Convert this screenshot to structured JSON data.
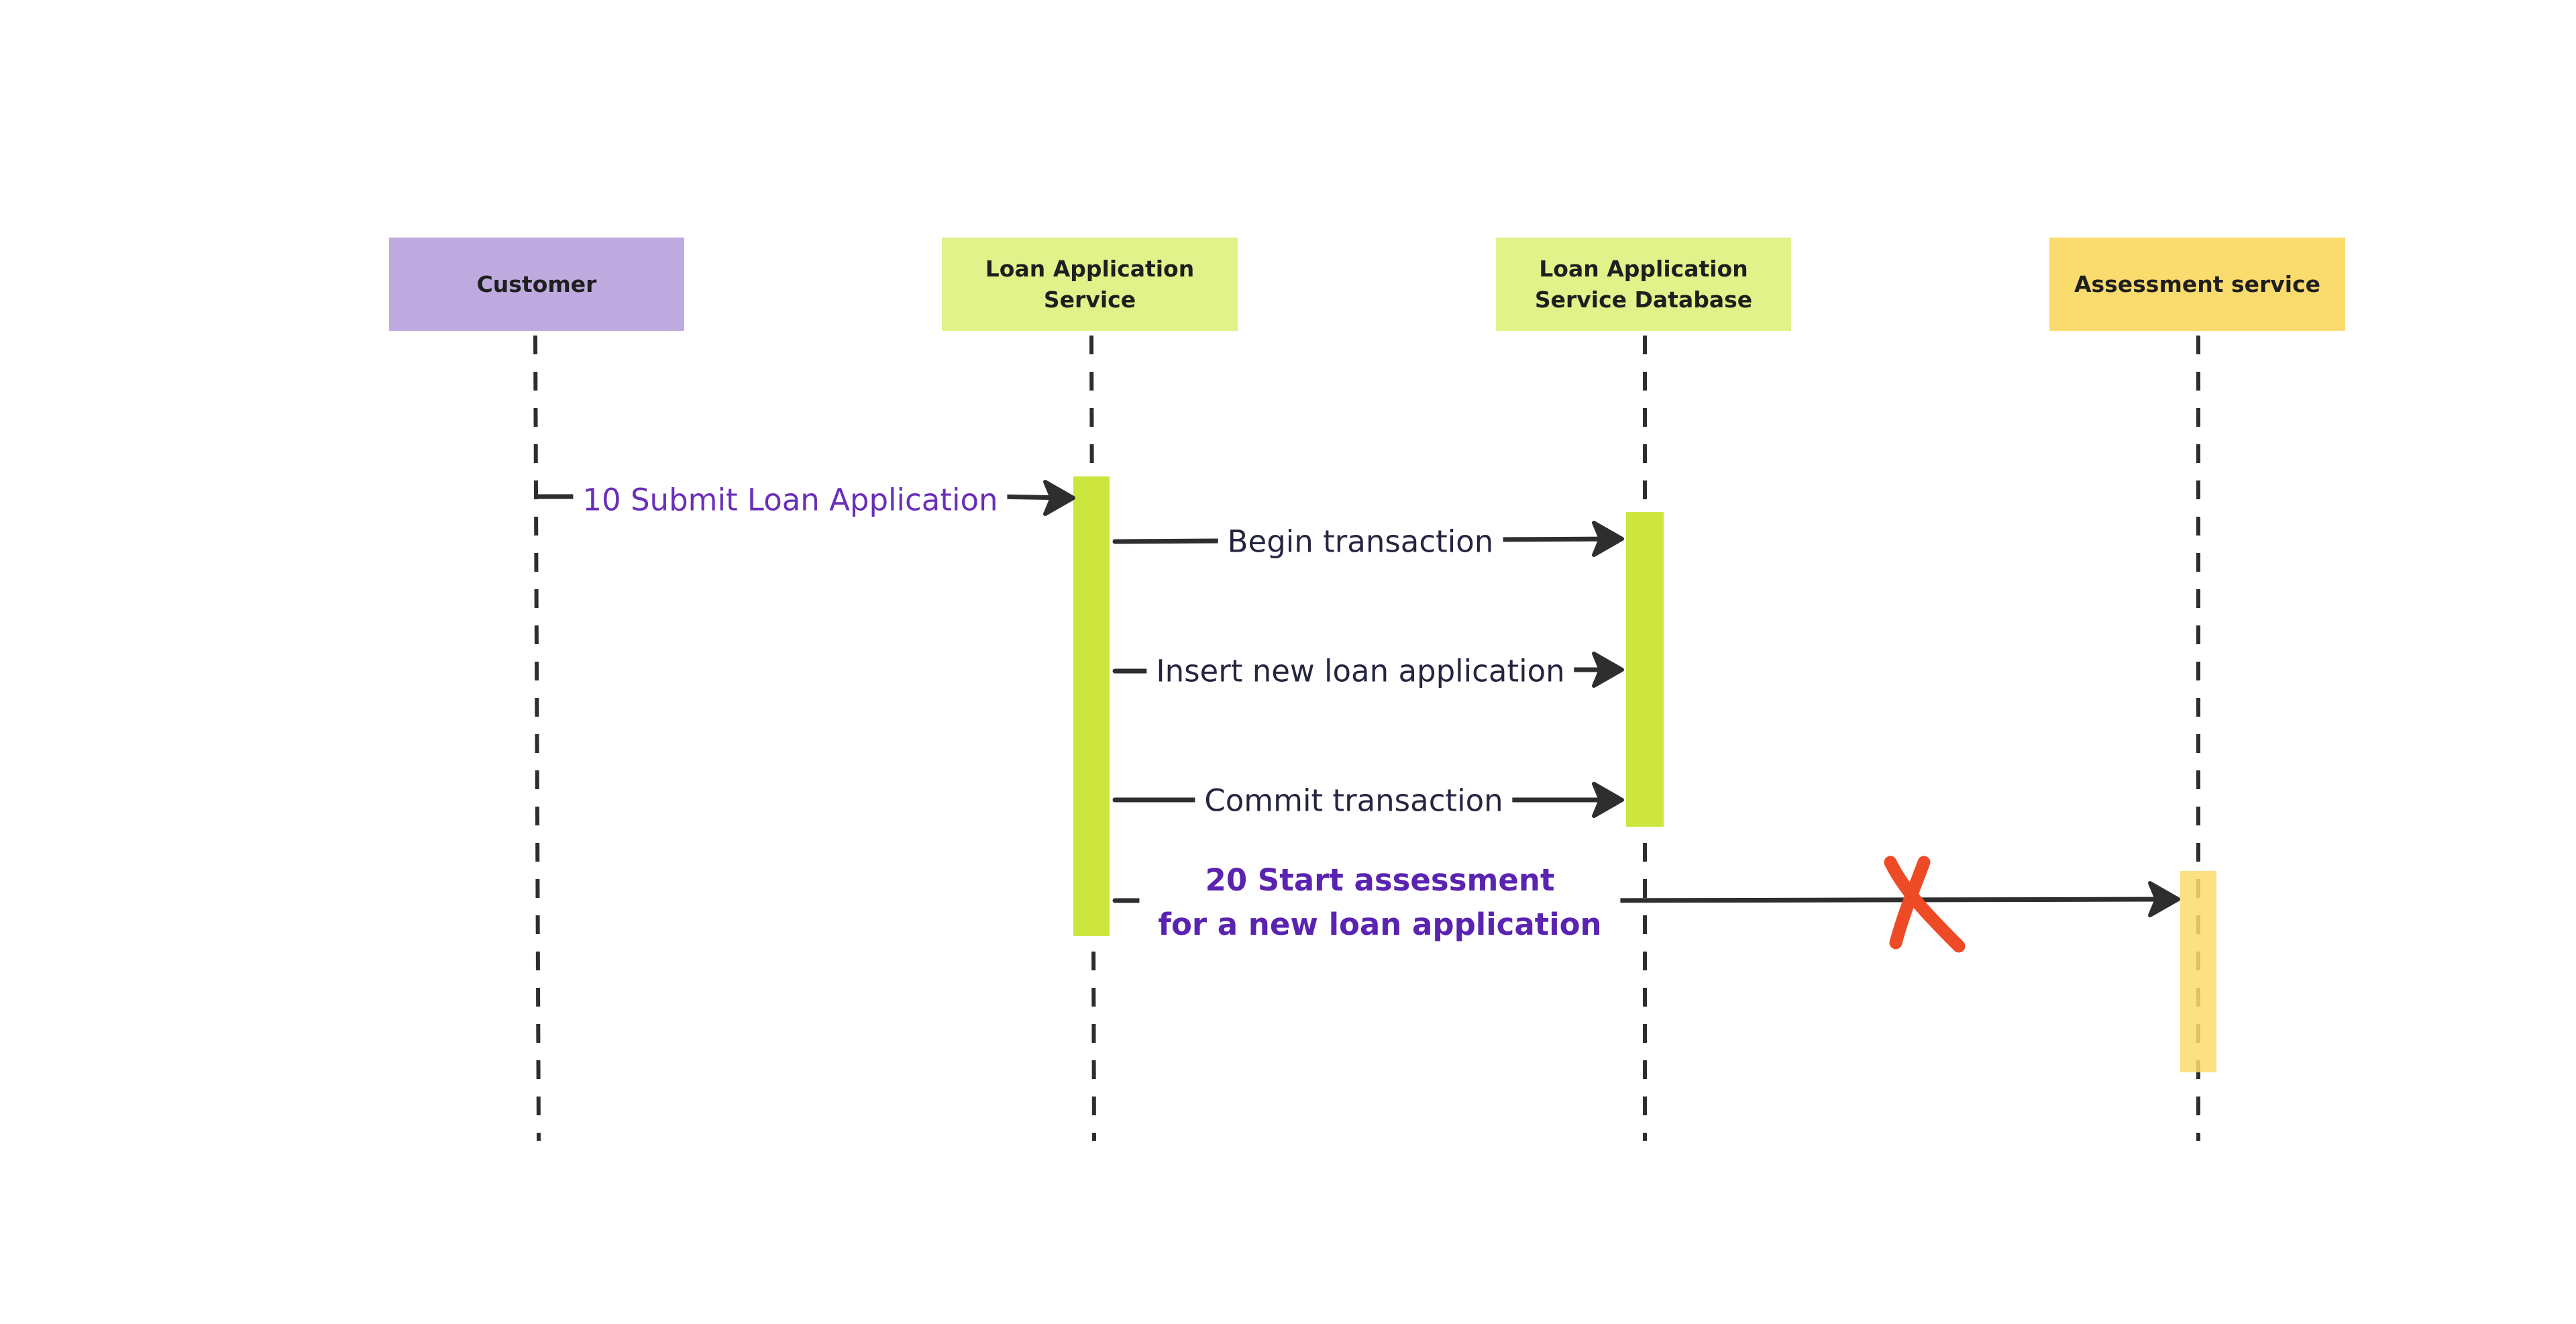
{
  "actors": [
    {
      "id": "customer",
      "label": "Customer",
      "color": "#bfaadf"
    },
    {
      "id": "las",
      "label": "Loan Application Service",
      "color": "#e2f28a"
    },
    {
      "id": "lasdb",
      "label": "Loan Application Service Database",
      "color": "#e2f28a"
    },
    {
      "id": "assessment",
      "label": "Assessment service",
      "color": "#fadb6e"
    }
  ],
  "messages": [
    {
      "from": "customer",
      "to": "las",
      "label": "10 Submit Loan Application",
      "style": "purple"
    },
    {
      "from": "las",
      "to": "lasdb",
      "label": "Begin transaction",
      "style": "normal"
    },
    {
      "from": "las",
      "to": "lasdb",
      "label": "Insert new loan application",
      "style": "normal"
    },
    {
      "from": "las",
      "to": "lasdb",
      "label": "Commit transaction",
      "style": "normal"
    },
    {
      "from": "las",
      "to": "assessment",
      "label": "20 Start assessment\nfor a new loan application",
      "style": "bold",
      "crossed_out": true
    }
  ],
  "activations": [
    {
      "actor": "las",
      "color": "#cde63f"
    },
    {
      "actor": "lasdb",
      "color": "#cde63f"
    },
    {
      "actor": "assessment",
      "color": "#fadb6e"
    }
  ],
  "colors": {
    "line": "#2e2e2e",
    "cross": "#ee4a26"
  }
}
